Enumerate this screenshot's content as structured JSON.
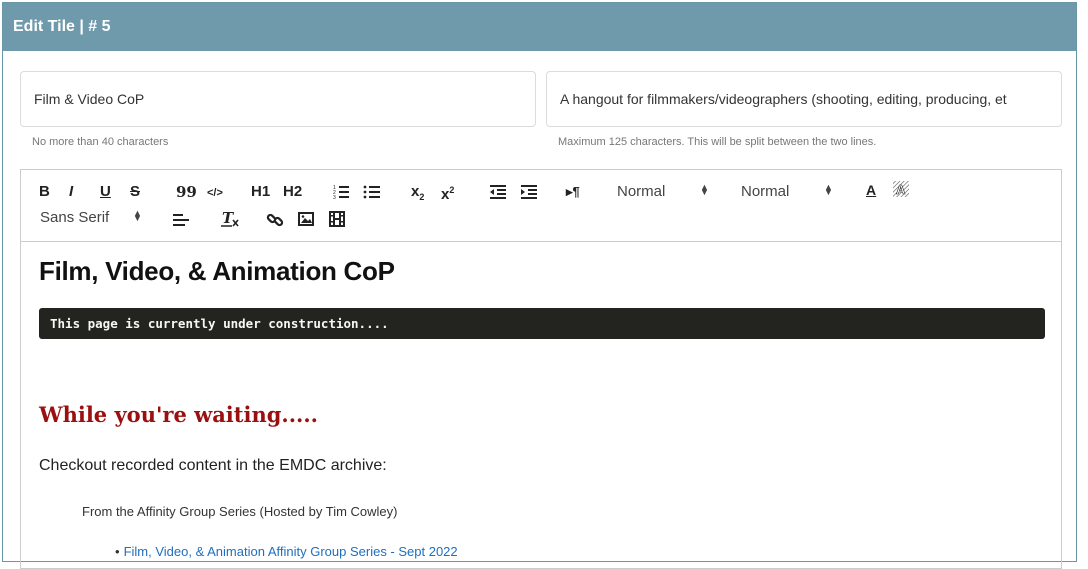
{
  "header": {
    "title": "Edit Tile | # 5"
  },
  "fields": {
    "title": {
      "value": "Film & Video CoP",
      "hint": "No more than 40 characters"
    },
    "description": {
      "value": "A hangout for filmmakers/videographers (shooting, editing, producing, et",
      "hint": "Maximum 125 characters. This will be split between the two lines."
    }
  },
  "toolbar": {
    "bold": "B",
    "italic": "I",
    "underline": "U",
    "strike": "S",
    "blockquote": "99",
    "code": "</>",
    "h1": "H1",
    "h2": "H2",
    "subscript": "x",
    "superscript": "x",
    "direction": "▸¶",
    "header_picker": "Normal",
    "size_picker": "Normal",
    "font_picker": "Sans Serif",
    "font_color": "A",
    "background_color": "A"
  },
  "content": {
    "heading": "Film, Video, & Animation CoP",
    "code_block": "This page is currently under construction....",
    "subheading": "While you're waiting.....",
    "paragraph": "Checkout recorded content in the EMDC archive:",
    "series_line": "From the Affinity Group Series (Hosted by Tim Cowley)",
    "list_item": "Film, Video, & Animation Affinity Group Series - Sept 2022"
  },
  "colors": {
    "header_bg": "#6e9aab",
    "subheading": "#9a0f0f",
    "link": "#1f6fbf",
    "code_bg": "#23241f"
  }
}
